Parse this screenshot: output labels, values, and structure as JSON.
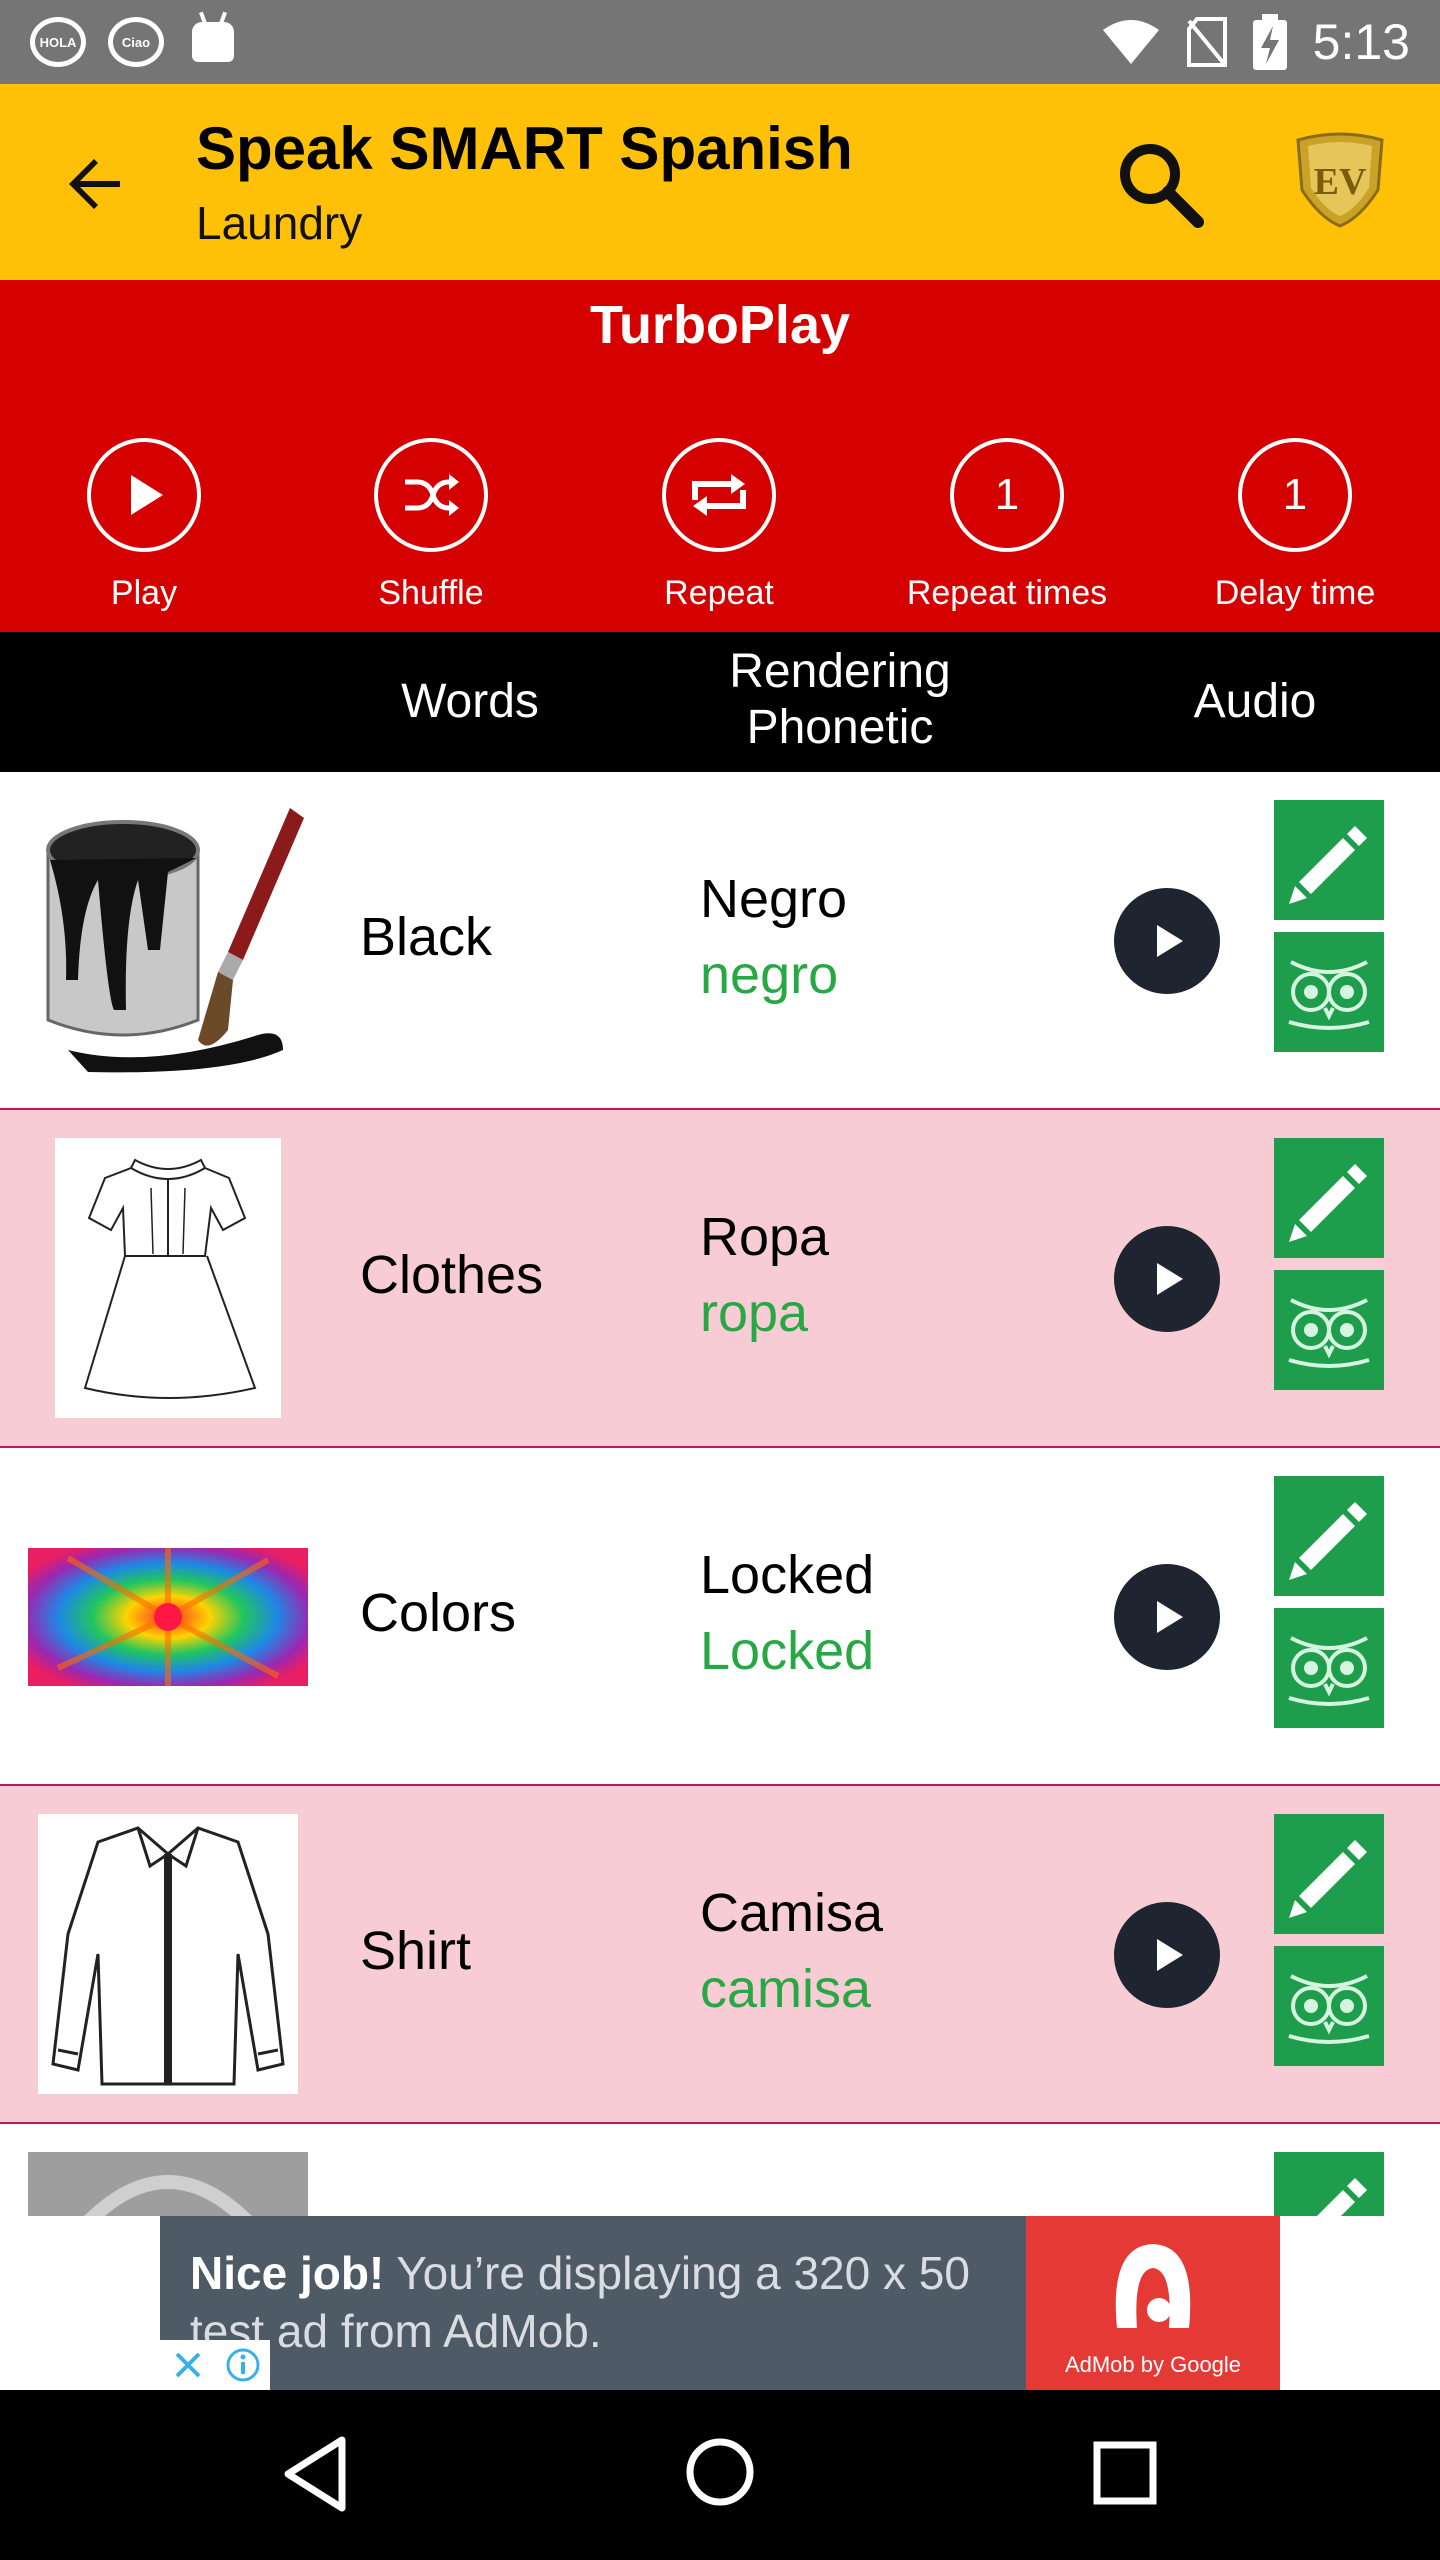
{
  "status_bar": {
    "time": "5:13",
    "left_icons": [
      "hola-bubble-icon",
      "ciao-bubble-icon",
      "android-icon"
    ],
    "hola": "HOLA",
    "ciao": "Ciao",
    "right_icons": [
      "wifi-icon",
      "no-sim-icon",
      "battery-charging-icon"
    ]
  },
  "app_bar": {
    "title": "Speak SMART Spanish",
    "subtitle": "Laundry",
    "back_icon": "arrow-left-icon",
    "search_icon": "search-icon",
    "logo_letters": "EV"
  },
  "turbo": {
    "title": "TurboPlay",
    "buttons": [
      {
        "label": "Play",
        "icon": "play-icon"
      },
      {
        "label": "Shuffle",
        "icon": "shuffle-icon"
      },
      {
        "label": "Repeat",
        "icon": "repeat-icon"
      },
      {
        "label": "Repeat times",
        "value": "1"
      },
      {
        "label": "Delay time",
        "value": "1"
      }
    ]
  },
  "table_header": {
    "words": "Words",
    "rendering": "Rendering",
    "phonetic": "Phonetic",
    "audio": "Audio"
  },
  "rows": [
    {
      "word": "Black",
      "spanish": "Negro",
      "phonetic": "negro",
      "image": "paint-bucket-brush-image"
    },
    {
      "word": "Clothes",
      "spanish": "Ropa",
      "phonetic": "ropa",
      "image": "dress-sketch-image"
    },
    {
      "word": "Colors",
      "spanish": "Locked",
      "phonetic": "Locked",
      "image": "colorful-flower-image"
    },
    {
      "word": "Shirt",
      "spanish": "Camisa",
      "phonetic": "camisa",
      "image": "shirt-sketch-image"
    }
  ],
  "ad": {
    "bold": "Nice job!",
    "text": " You’re displaying a 320 x 50 test ad from AdMob.",
    "brand": "AdMob by Google"
  },
  "nav_bar": {
    "icons": [
      "back-triangle-icon",
      "home-circle-icon",
      "recents-square-icon"
    ]
  },
  "colors": {
    "app_bar": "#FFC107",
    "turbo": "#D50000",
    "pink_row": "#F8CCD5",
    "phonetic_green": "#28A745",
    "button_green": "#1E9E4C"
  }
}
